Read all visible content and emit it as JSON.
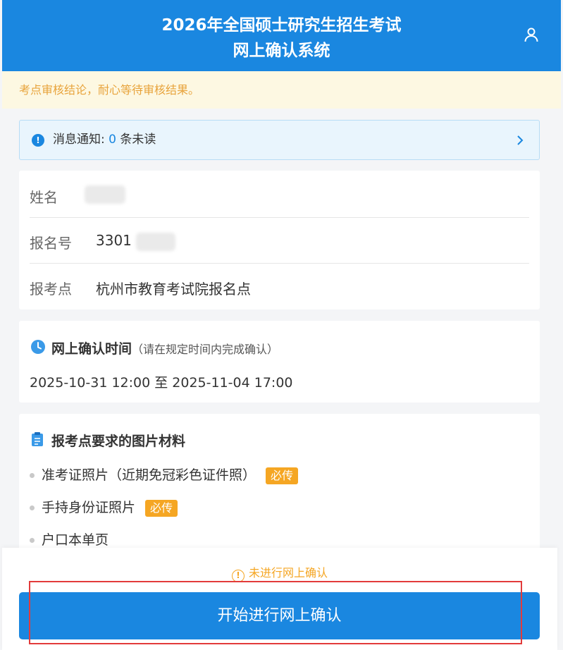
{
  "header": {
    "title_line1": "2026年全国硕士研究生招生考试",
    "title_line2": "网上确认系统",
    "user_icon": "user-icon"
  },
  "notice": "考点审核结论，耐心等待审核结果。",
  "message": {
    "label": "消息通知:",
    "count": "0",
    "unit": "条未读"
  },
  "candidate": {
    "name_label": "姓名",
    "regno_label": "报名号",
    "regno_value": "3301",
    "site_label": "报考点",
    "site_value": "杭州市教育考试院报名点"
  },
  "confirm_time": {
    "title": "网上确认时间",
    "subtitle": "（请在规定时间内完成确认）",
    "range": "2025-10-31 12:00 至 2025-11-04 17:00"
  },
  "materials": {
    "title": "报考点要求的图片材料",
    "items": [
      {
        "label": "准考证照片（近期免冠彩色证件照）",
        "badge": "必传"
      },
      {
        "label": "手持身份证照片",
        "badge": "必传"
      },
      {
        "label": "户口本单页",
        "badge": ""
      }
    ]
  },
  "footer": {
    "status": "未进行网上确认",
    "button": "开始进行网上确认"
  },
  "colors": {
    "primary": "#1a87e0",
    "warning": "#f5a623",
    "highlight": "#e23b3b"
  }
}
